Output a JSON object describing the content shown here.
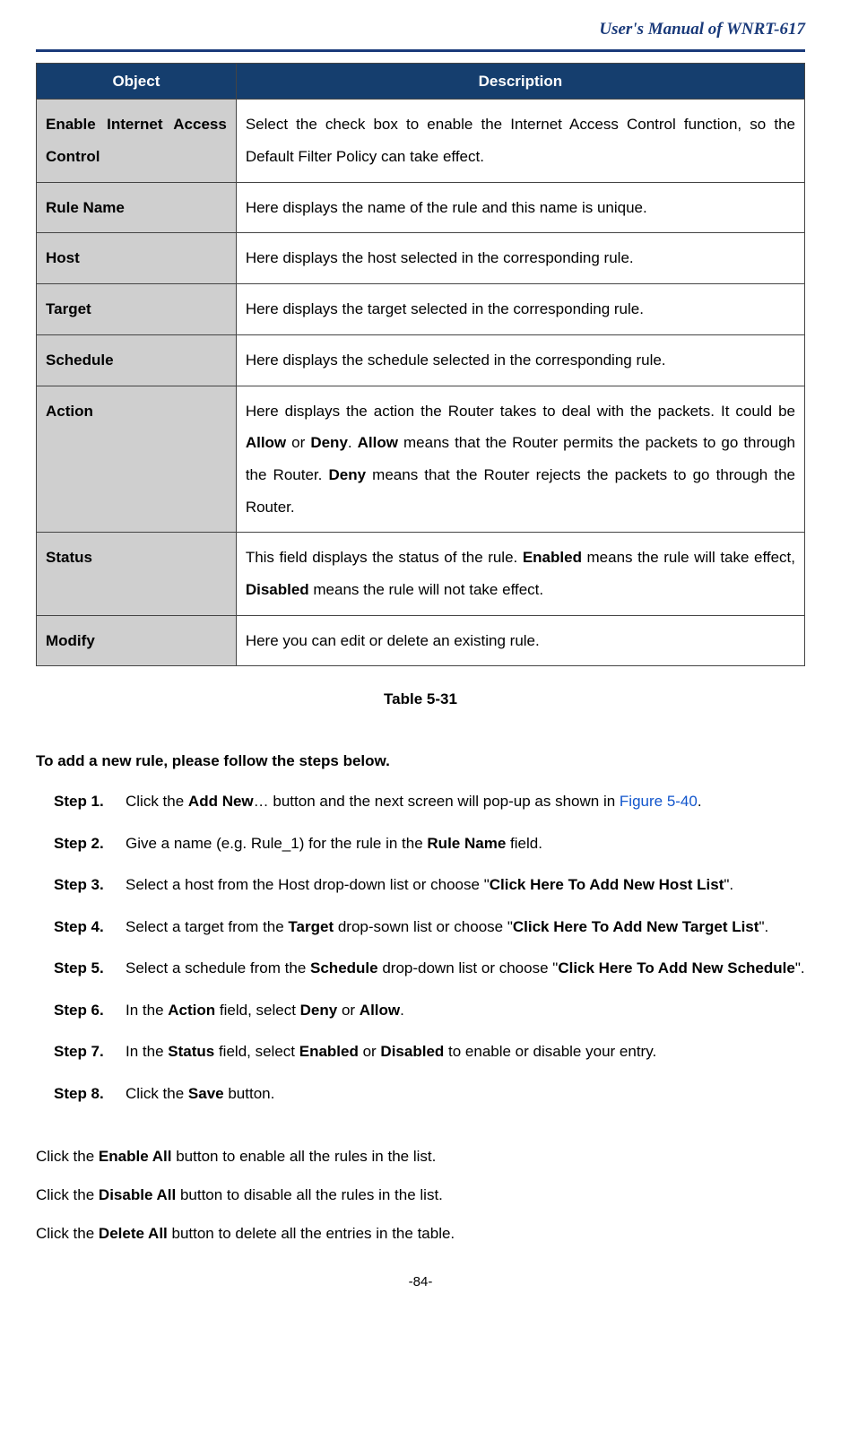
{
  "header": {
    "title": "User's Manual of WNRT-617"
  },
  "table": {
    "head": {
      "col1": "Object",
      "col2": "Description"
    },
    "rows": [
      {
        "obj": "Enable Internet Access Control",
        "desc": "Select the check box to enable the Internet Access Control function, so the Default Filter Policy can take effect."
      },
      {
        "obj": "Rule Name",
        "desc": "Here displays the name of the rule and this name is unique."
      },
      {
        "obj": "Host",
        "desc": "Here displays the host selected in the corresponding rule."
      },
      {
        "obj": "Target",
        "desc": "Here displays the target selected in the corresponding rule."
      },
      {
        "obj": "Schedule",
        "desc": "Here displays the schedule selected in the corresponding rule."
      },
      {
        "obj": "Action",
        "desc_html": "Here displays the action the Router takes to deal with the packets. It could be <b>Allow</b> or <b>Deny</b>. <b>Allow</b> means that the Router permits the packets to go through the Router. <b>Deny</b> means that the Router rejects the packets to go through the Router."
      },
      {
        "obj": "Status",
        "desc_html": "This field displays the status of the rule. <b>Enabled</b> means the rule will take effect, <b>Disabled</b> means the rule will not take effect."
      },
      {
        "obj": "Modify",
        "desc": "Here you can edit or delete an existing rule."
      }
    ],
    "caption": "Table 5-31"
  },
  "section_title": "To add a new rule, please follow the steps below.",
  "steps": [
    {
      "label": "Step 1.",
      "html": "Click the <b>Add New</b>… button and the next screen will pop-up as shown in <span class=\"link\">Figure 5-40</span>."
    },
    {
      "label": "Step 2.",
      "html": "Give a name (e.g. Rule_1) for the rule in the <b>Rule Name</b> field."
    },
    {
      "label": "Step 3.",
      "html": "Select a host from the Host drop-down list or choose \"<b>Click Here To Add New Host List</b>\"."
    },
    {
      "label": "Step 4.",
      "html": "Select a target from the <b>Target</b> drop-sown list or choose \"<b>Click Here To Add New Target List</b>\"."
    },
    {
      "label": "Step 5.",
      "html": "Select a schedule from the <b>Schedule</b> drop-down list or choose \"<b>Click Here To Add New Schedule</b>\"."
    },
    {
      "label": "Step 6.",
      "html": "In the <b>Action</b> field, select <b>Deny</b> or <b>Allow</b>."
    },
    {
      "label": "Step 7.",
      "html": "In the <b>Status</b> field, select <b>Enabled</b> or <b>Disabled</b> to enable or disable your entry."
    },
    {
      "label": "Step 8.",
      "html": "Click the <b>Save</b> button."
    }
  ],
  "notes": [
    {
      "html": "Click the <b>Enable All</b> button to enable all the rules in the list."
    },
    {
      "html": "Click the <b>Disable All</b> button to disable all the rules in the list."
    },
    {
      "html": "Click the <b>Delete All</b> button to delete all the entries in the table."
    }
  ],
  "page_number": "-84-"
}
